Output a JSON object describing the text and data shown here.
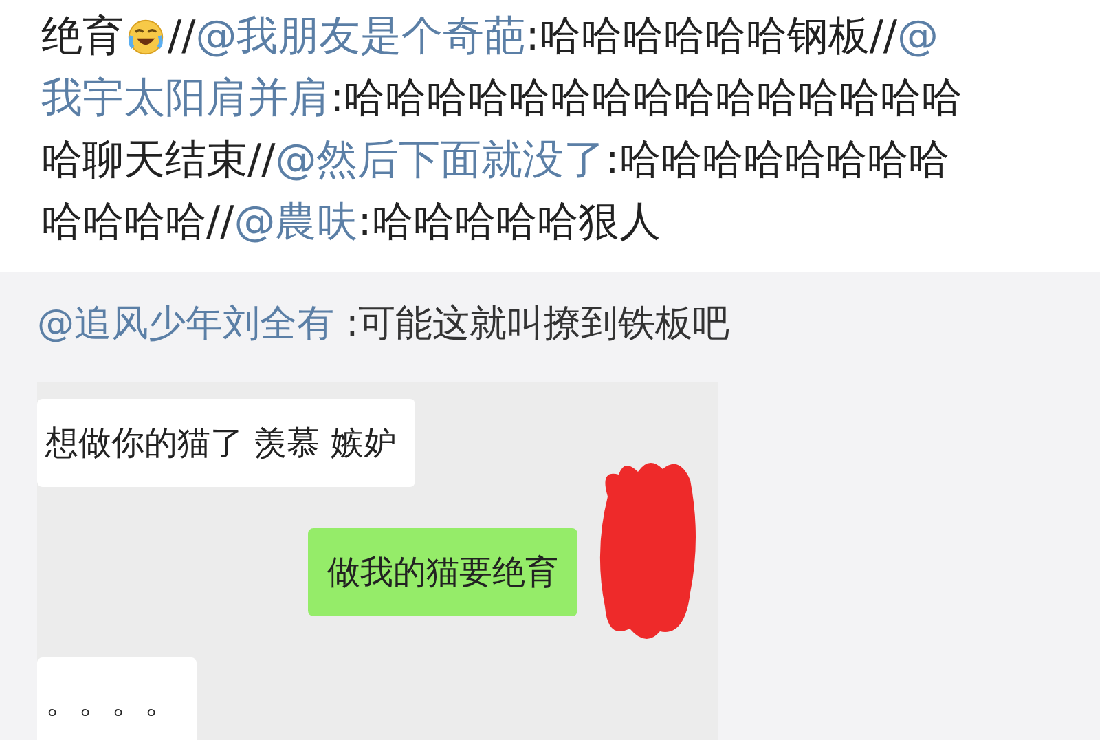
{
  "post": {
    "lines": [
      [
        {
          "kind": "text",
          "text": "绝育"
        },
        {
          "kind": "emoji"
        },
        {
          "kind": "text",
          "text": "//"
        },
        {
          "kind": "mention",
          "text": "@我朋友是个奇葩"
        },
        {
          "kind": "text",
          "text": ":哈哈哈哈哈哈钢板//"
        },
        {
          "kind": "mention",
          "text": "@"
        }
      ],
      [
        {
          "kind": "mention",
          "text": "我宇太阳肩并肩"
        },
        {
          "kind": "text",
          "text": ":哈哈哈哈哈哈哈哈哈哈哈哈哈哈哈"
        }
      ],
      [
        {
          "kind": "text",
          "text": "哈聊天结束//"
        },
        {
          "kind": "mention",
          "text": "@然后下面就没了"
        },
        {
          "kind": "text",
          "text": ":哈哈哈哈哈哈哈哈"
        }
      ],
      [
        {
          "kind": "text",
          "text": "哈哈哈哈//"
        },
        {
          "kind": "mention",
          "text": "@農呋"
        },
        {
          "kind": "text",
          "text": ":哈哈哈哈哈狠人"
        }
      ]
    ]
  },
  "comment": {
    "mention": "@追风少年刘全有",
    "text": " :可能这就叫撩到铁板吧"
  },
  "chat": {
    "messages": [
      {
        "kind": "received",
        "text": "想做你的猫了  羡慕 嫉妒"
      },
      {
        "kind": "sent",
        "text": "做我的猫要绝育"
      },
      {
        "kind": "received",
        "text": "。。。。"
      }
    ]
  }
}
